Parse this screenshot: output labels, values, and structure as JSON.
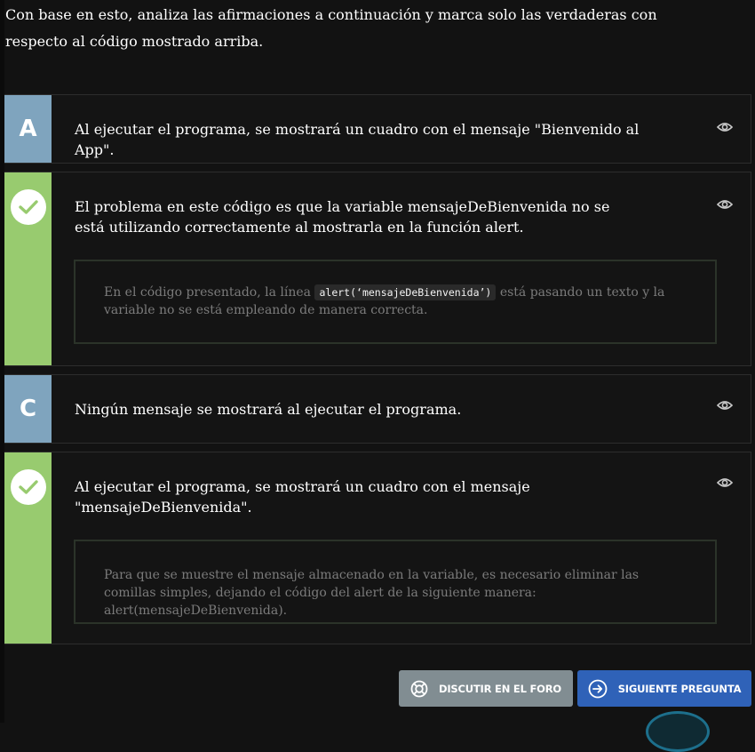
{
  "question": {
    "text": "Con base en esto, analiza las afirmaciones a continuación y marca solo las verdaderas con respecto al código mostrado arriba."
  },
  "options": [
    {
      "badge": "A",
      "state": "unselected",
      "text": "Al ejecutar el programa, se mostrará un cuadro con el mensaje \"Bienvenido al App\".",
      "icon": "eye-icon"
    },
    {
      "badge": "check-icon",
      "state": "correct",
      "text": "El problema en este código es que la variable mensajeDeBienvenida no se está utilizando correctamente al mostrarla en la función alert.",
      "icon": "eye-icon",
      "explanation": {
        "before": "En el código presentado, la línea",
        "code": "alert(‘mensajeDeBienvenida’)",
        "after": "está pasando un texto y la variable no se está empleando de manera correcta."
      }
    },
    {
      "badge": "C",
      "state": "unselected",
      "text": "Ningún mensaje se mostrará al ejecutar el programa.",
      "icon": "eye-icon"
    },
    {
      "badge": "check-icon",
      "state": "correct",
      "text": "Al ejecutar el programa, se mostrará un cuadro con el mensaje \"mensajeDeBienvenida\".",
      "icon": "eye-icon",
      "explanation": {
        "text": "Para que se muestre el mensaje almacenado en la variable, es necesario eliminar las comillas simples, dejando el código del alert de la siguiente manera: alert(mensajeDeBienvenida)."
      }
    }
  ],
  "buttons": {
    "forum": {
      "label": "DISCUTIR EN EL FORO",
      "icon": "lifebuoy-icon"
    },
    "next": {
      "label": "SIGUIENTE PREGUNTA",
      "icon": "arrow-circle-right-icon"
    }
  },
  "colors": {
    "background": "#121212",
    "letter_badge": "#7fa4be",
    "correct_badge": "#98cb6f",
    "forum_button": "#818d92",
    "next_button": "#2f62b8"
  }
}
